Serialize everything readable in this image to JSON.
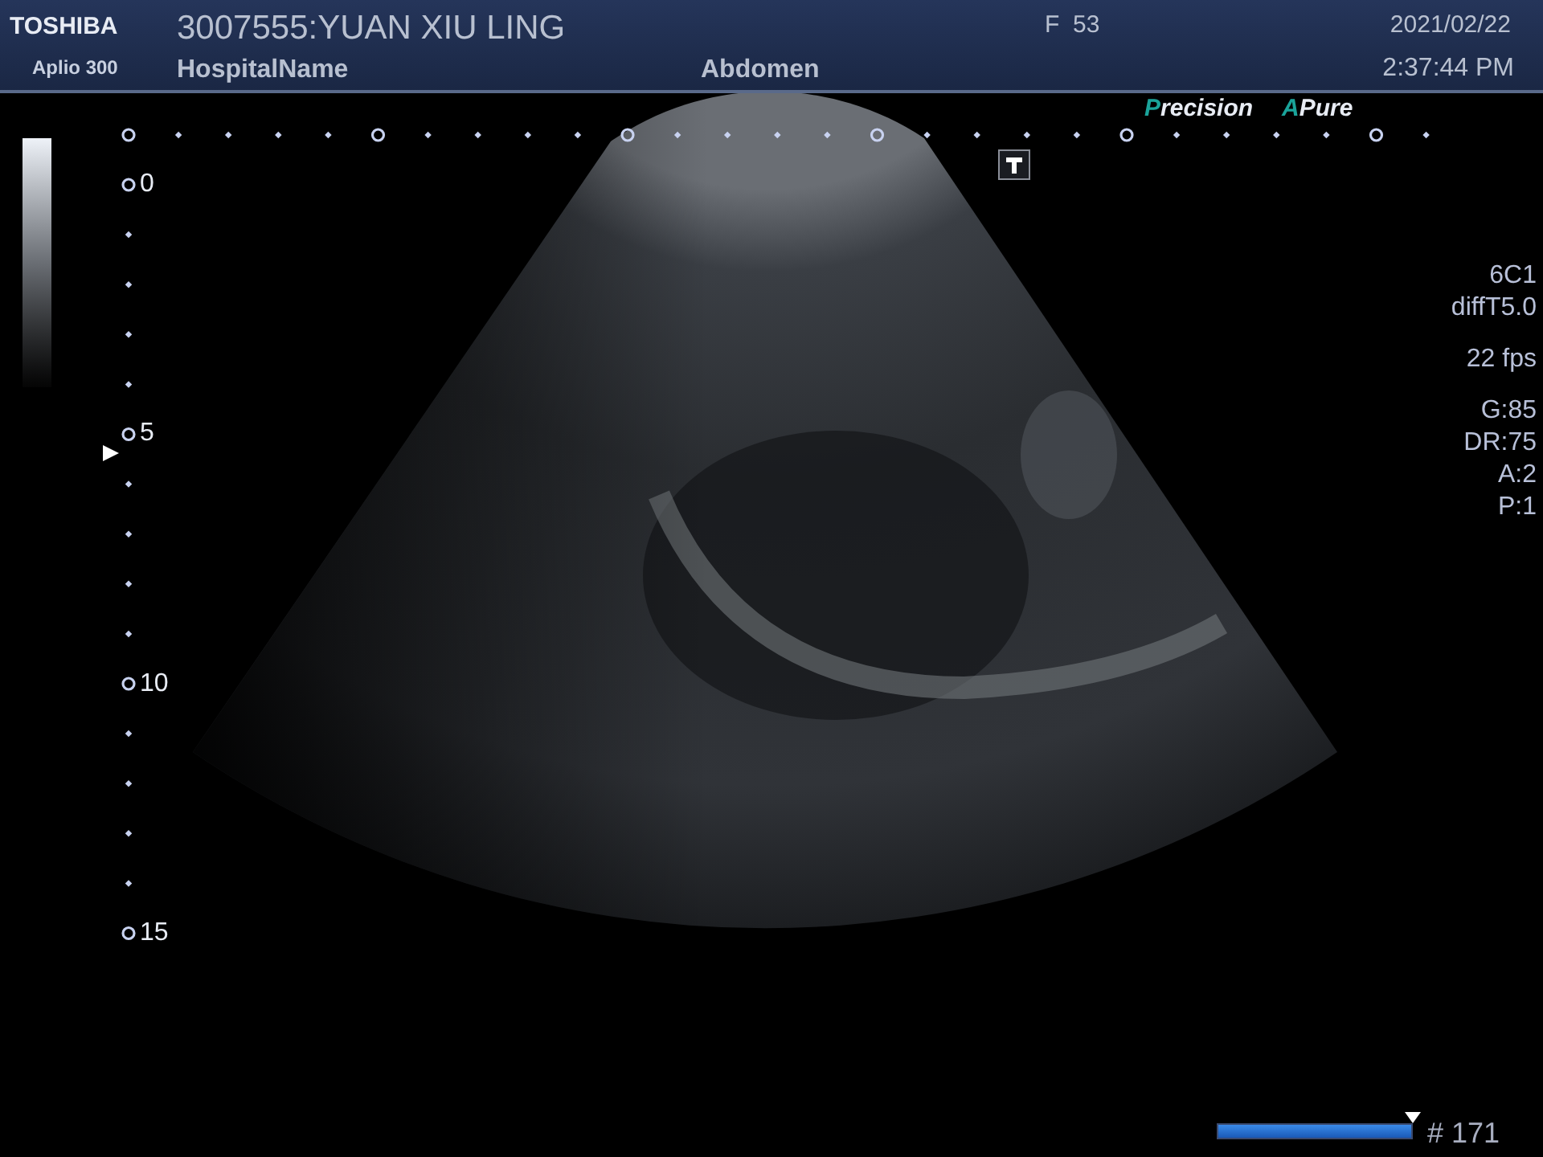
{
  "header": {
    "brand": "TOSHIBA",
    "model": "Aplio 300",
    "patient": "3007555:YUAN XIU LING",
    "hospital": "HospitalName",
    "exam": "Abdomen",
    "sex_age": "F  53",
    "date": "2021/02/22",
    "time": "2:37:44 PM"
  },
  "modes": [
    {
      "initial": "P",
      "rest": "recision"
    },
    {
      "initial": "A",
      "rest": "Pure"
    }
  ],
  "depth_labels": [
    "0",
    "5",
    "10",
    "15"
  ],
  "parameter_groups": [
    {
      "items": [
        "6C1",
        "diffT5.0"
      ]
    },
    {
      "items": [
        "22 fps"
      ]
    },
    {
      "items": [
        "G:85",
        "DR:75",
        "A:2",
        "P:1"
      ]
    }
  ],
  "cine": {
    "level": 1,
    "frame": "# 171"
  }
}
